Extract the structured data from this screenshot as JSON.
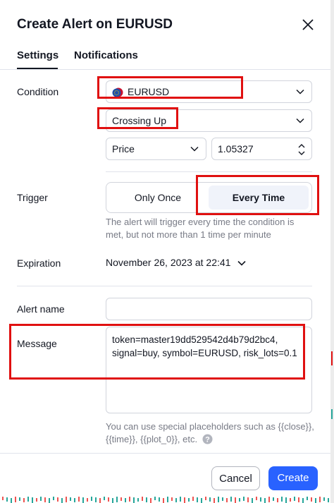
{
  "dialog": {
    "title": "Create Alert on EURUSD",
    "tabs": [
      {
        "label": "Settings",
        "active": true
      },
      {
        "label": "Notifications",
        "active": false
      }
    ]
  },
  "condition": {
    "label": "Condition",
    "symbol": "EURUSD",
    "operator": "Crossing Up",
    "source": "Price",
    "value": "1.05327"
  },
  "trigger": {
    "label": "Trigger",
    "options": [
      "Only Once",
      "Every Time"
    ],
    "selected": "Every Time",
    "hint_line1": "The alert will trigger every time the condition is",
    "hint_line2": "met, but not more than 1 time per minute"
  },
  "expiration": {
    "label": "Expiration",
    "value": "November 26, 2023 at 22:41"
  },
  "alert_name": {
    "label": "Alert name",
    "value": ""
  },
  "message": {
    "label": "Message",
    "line1": "token=master19dd529542d4b79d2bc4,",
    "line2": "signal=buy, symbol=EURUSD, risk_lots=0.1",
    "hint_line1": "You can use special placeholders such as {{close}},",
    "hint_line2": "{{time}}, {{plot_0}}, etc."
  },
  "buttons": {
    "cancel": "Cancel",
    "create": "Create"
  },
  "colors": {
    "accent": "#2962ff",
    "highlight": "#e01010",
    "selected_segment": "#f0f3fa"
  },
  "icons": [
    "close-icon",
    "eurusd-flag-icon",
    "chevron-down-icon",
    "stepper-icon",
    "help-icon"
  ]
}
